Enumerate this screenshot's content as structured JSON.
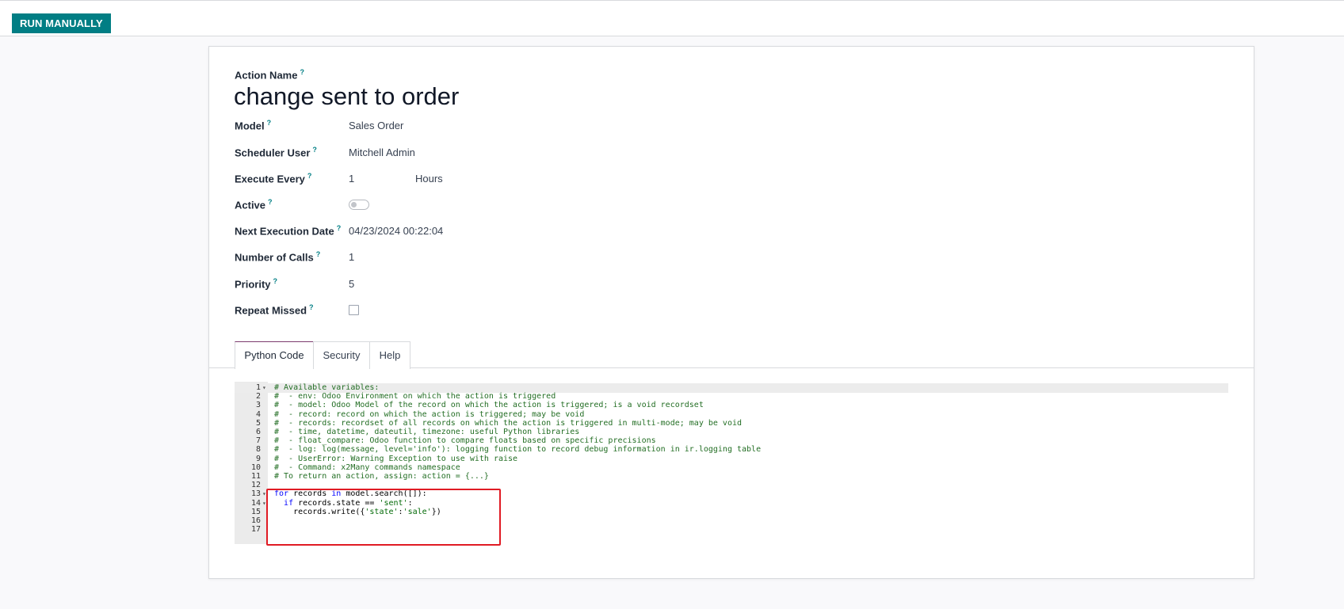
{
  "toolbar": {
    "run_label": "RUN MANUALLY"
  },
  "form": {
    "name_label": "Action Name",
    "name_value": "change sent to order",
    "help_mark": "?",
    "fields": {
      "model": {
        "label": "Model",
        "value": "Sales Order"
      },
      "scheduler_user": {
        "label": "Scheduler User",
        "value": "Mitchell Admin"
      },
      "execute_every": {
        "label": "Execute Every",
        "value": "1",
        "unit": "Hours"
      },
      "active": {
        "label": "Active",
        "value": false
      },
      "next_execution": {
        "label": "Next Execution Date",
        "value": "04/23/2024 00:22:04"
      },
      "number_of_calls": {
        "label": "Number of Calls",
        "value": "1"
      },
      "priority": {
        "label": "Priority",
        "value": "5"
      },
      "repeat_missed": {
        "label": "Repeat Missed",
        "value": false
      }
    }
  },
  "tabs": [
    {
      "label": "Python Code",
      "active": true
    },
    {
      "label": "Security",
      "active": false
    },
    {
      "label": "Help",
      "active": false
    }
  ],
  "code_lines": [
    "# Available variables:",
    "#  - env: Odoo Environment on which the action is triggered",
    "#  - model: Odoo Model of the record on which the action is triggered; is a void recordset",
    "#  - record: record on which the action is triggered; may be void",
    "#  - records: recordset of all records on which the action is triggered in multi-mode; may be void",
    "#  - time, datetime, dateutil, timezone: useful Python libraries",
    "#  - float_compare: Odoo function to compare floats based on specific precisions",
    "#  - log: log(message, level='info'): logging function to record debug information in ir.logging table",
    "#  - UserError: Warning Exception to use with raise",
    "#  - Command: x2Many commands namespace",
    "# To return an action, assign: action = {...}",
    "",
    "for records in model.search([]):",
    "  if records.state == 'sent':",
    "    records.write({'state':'sale'})",
    "",
    ""
  ],
  "colors": {
    "primary": "#017e84",
    "tab_active_border": "#7c3a6d",
    "annotation_red": "#e01b24",
    "comment": "#236e24",
    "keyword": "#0000ff"
  }
}
